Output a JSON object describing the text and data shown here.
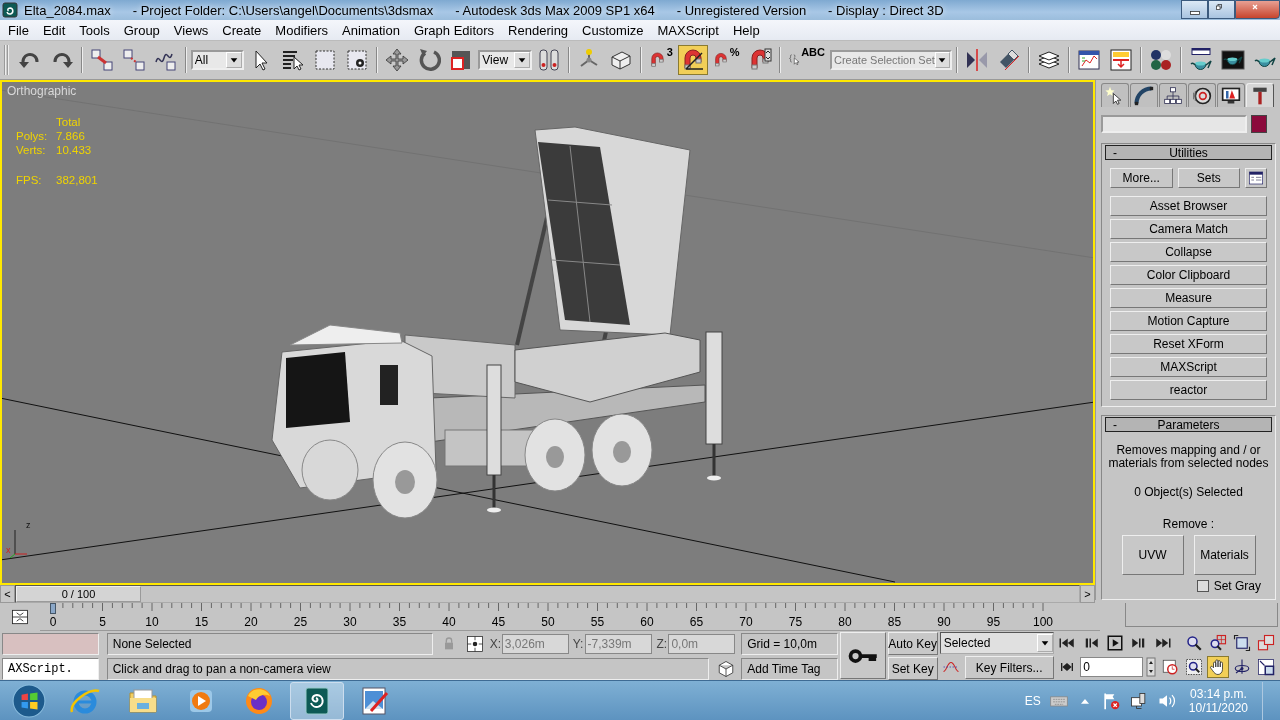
{
  "window": {
    "title_segments": [
      "Elta_2084.max",
      "- Project Folder: C:\\Users\\angel\\Documents\\3dsmax",
      "- Autodesk 3ds Max  2009 SP1  x64",
      "- Unregistered Version",
      "- Display : Direct 3D"
    ]
  },
  "menu": [
    "File",
    "Edit",
    "Tools",
    "Group",
    "Views",
    "Create",
    "Modifiers",
    "Animation",
    "Graph Editors",
    "Rendering",
    "Customize",
    "MAXScript",
    "Help"
  ],
  "toolbar": [
    {
      "kind": "undo",
      "on": false
    },
    {
      "kind": "redo",
      "on": false
    },
    {
      "kind": "link",
      "on": false,
      "sep": true
    },
    {
      "kind": "unlink",
      "on": false
    },
    {
      "kind": "bind",
      "on": false
    },
    {
      "kind": "dropdown",
      "value": "All",
      "sep": true
    },
    {
      "kind": "select",
      "on": false
    },
    {
      "kind": "select-name",
      "on": false
    },
    {
      "kind": "rect-region",
      "on": false
    },
    {
      "kind": "window-crossing",
      "on": false
    },
    {
      "kind": "move",
      "on": false,
      "sep": true
    },
    {
      "kind": "rotate",
      "on": false
    },
    {
      "kind": "scale",
      "on": false
    },
    {
      "kind": "dropdown",
      "value": "View"
    },
    {
      "kind": "pivot",
      "on": false
    },
    {
      "kind": "manipulate",
      "on": false,
      "sep": true
    },
    {
      "kind": "keyboard",
      "on": false
    },
    {
      "kind": "snap",
      "on": false,
      "badge": "3",
      "sep": true
    },
    {
      "kind": "angle-snap",
      "on": true
    },
    {
      "kind": "snap",
      "on": false,
      "badge": "%"
    },
    {
      "kind": "spinner-snap",
      "on": false
    },
    {
      "kind": "named-sel",
      "on": false,
      "badge": "ABC",
      "sep": true
    },
    {
      "kind": "dropdown",
      "placeholder": "Create Selection Set"
    },
    {
      "kind": "mirror",
      "on": false,
      "sep": true
    },
    {
      "kind": "align",
      "on": false
    },
    {
      "kind": "layers",
      "on": false,
      "sep": true
    },
    {
      "kind": "curve-editor",
      "on": false,
      "sep": true
    },
    {
      "kind": "schematic",
      "on": false
    },
    {
      "kind": "material",
      "on": false,
      "sep": true
    },
    {
      "kind": "render-setup",
      "on": false,
      "sep": true
    },
    {
      "kind": "rendered-frame",
      "on": false
    },
    {
      "kind": "render",
      "on": false
    }
  ],
  "viewport": {
    "label": "Orthographic",
    "stats_heading": "Total",
    "stats": [
      {
        "label": "Polys:",
        "value": "7.866"
      },
      {
        "label": "Verts:",
        "value": "10.433"
      },
      {
        "label": "FPS:",
        "value": "382,801"
      }
    ],
    "axis_labels": [
      "z",
      "x"
    ]
  },
  "command_panel": {
    "tabs": [
      {
        "kind": "create",
        "selected": false
      },
      {
        "kind": "modify",
        "selected": false
      },
      {
        "kind": "hierarchy",
        "selected": false
      },
      {
        "kind": "motion",
        "selected": false
      },
      {
        "kind": "display",
        "selected": false
      },
      {
        "kind": "utilities",
        "selected": true
      }
    ],
    "utilities": {
      "toggle": "-",
      "title": "Utilities",
      "more": "More...",
      "sets": "Sets",
      "buttons": [
        "Asset Browser",
        "Camera Match",
        "Collapse",
        "Color Clipboard",
        "Measure",
        "Motion Capture",
        "Reset XForm",
        "MAXScript",
        "reactor"
      ]
    },
    "parameters": {
      "toggle": "-",
      "title": "Parameters",
      "description": "Removes mapping and / or materials from selected nodes",
      "count": "0 Object(s) Selected",
      "remove_label": "Remove :",
      "buttons": [
        "UVW",
        "Materials"
      ],
      "set_gray": {
        "label": "Set Gray",
        "checked": false
      }
    }
  },
  "time_slider": {
    "prev": "<",
    "label": "0 / 100",
    "level": 0,
    "next": ">"
  },
  "track_bar": {
    "ticks": [
      "0",
      "5",
      "10",
      "15",
      "20",
      "25",
      "30",
      "35",
      "40",
      "45",
      "50",
      "55",
      "60",
      "65",
      "70",
      "75",
      "80",
      "85",
      "90",
      "95",
      "100"
    ]
  },
  "status": {
    "listener": "AXScript.",
    "selection": "None Selected",
    "prompt": "Click and drag to pan a non-camera view",
    "x_label": "X:",
    "x": "3,026m",
    "y_label": "Y:",
    "y": "-7,339m",
    "z_label": "Z:",
    "z": "0,0m",
    "grid": "Grid = 10,0m",
    "time_tag": "Add Time Tag",
    "auto_key": "Auto Key",
    "set_key": "Set Key",
    "key_mode": "Selected",
    "key_filters": "Key Filters...",
    "frame": "0"
  },
  "navigation": [
    {
      "kind": "zoom",
      "on": false
    },
    {
      "kind": "zoom-all",
      "on": false
    },
    {
      "kind": "zoom-extents",
      "on": false
    },
    {
      "kind": "zoom-extents-all",
      "on": false
    },
    {
      "kind": "zoom-region",
      "on": false
    },
    {
      "kind": "pan",
      "on": true
    },
    {
      "kind": "orbit",
      "on": false
    },
    {
      "kind": "maximize",
      "on": false
    }
  ],
  "taskbar": {
    "apps": [
      {
        "kind": "browser-e",
        "selected": false
      },
      {
        "kind": "folder",
        "selected": false
      },
      {
        "kind": "media",
        "selected": false
      },
      {
        "kind": "fox",
        "selected": false
      },
      {
        "kind": "max",
        "selected": true
      },
      {
        "kind": "paint",
        "selected": false
      }
    ],
    "language": "ES",
    "time": "03:14 p.m.",
    "date": "10/11/2020"
  }
}
